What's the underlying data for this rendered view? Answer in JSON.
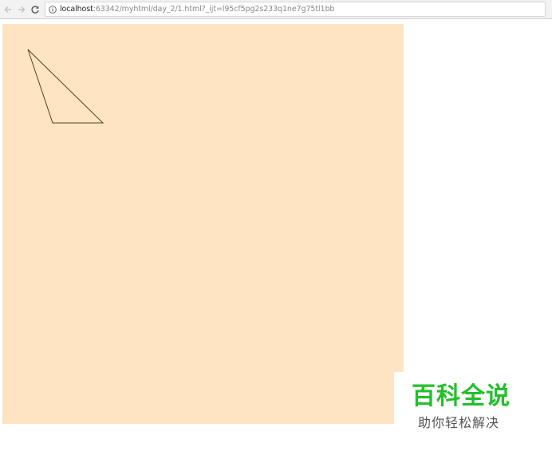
{
  "browser": {
    "url_host": "localhost",
    "url_rest": ":63342/myhtml/day_2/1.html?_ijt=l95cf5pg2s233q1ne7g75tl1bb",
    "icons": {
      "back": "arrow-left-icon",
      "forward": "arrow-right-icon",
      "reload": "reload-icon",
      "info": "info-icon"
    }
  },
  "canvas": {
    "background_color": "#ffe4c4",
    "shape": "triangle",
    "stroke_color": "#5a3b1e"
  },
  "watermark": {
    "title": "百科全说",
    "subtitle": "助你轻松解决",
    "title_color": "#22c02a",
    "subtitle_color": "#555555"
  }
}
